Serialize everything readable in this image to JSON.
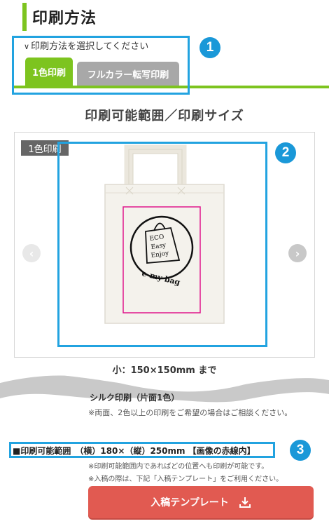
{
  "title": "印刷方法",
  "print_method": {
    "select_label": "印刷方法を選択してください",
    "tabs": [
      {
        "label": "1色印刷",
        "active": true
      },
      {
        "label": "フルカラー転写印刷",
        "active": false
      }
    ]
  },
  "range_title": "印刷可能範囲／印刷サイズ",
  "product": {
    "tag": "1色印刷",
    "size_text": "小：150×150mm まで",
    "print_logo_lines": [
      "ECO",
      "Easy",
      "Enjoy"
    ],
    "print_logo_brand": "e-my bag"
  },
  "silk": {
    "title": "シルク印刷（片面1色）",
    "note": "※両面、2色以上の印刷をご希望の場合はご相談ください。"
  },
  "range_spec": "■印刷可能範囲　（横）180×（縦）250mm 【画像の赤線内】",
  "notes": [
    "※印刷可能範囲内であればどの位置へも印刷が可能です。",
    "※入稿の際は、下記「入稿テンプレート」をご利用ください。"
  ],
  "template_button": "入稿テンプレート",
  "badges": [
    "1",
    "2",
    "3"
  ],
  "colors": {
    "accent_green": "#7dc41f",
    "annotation_blue": "#22a3e0",
    "button_red": "#e15a51",
    "print_area_pink": "#e0168b"
  }
}
